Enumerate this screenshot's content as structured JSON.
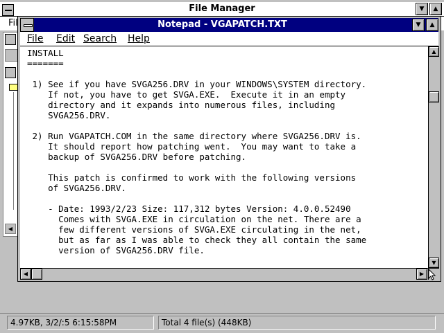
{
  "file_manager": {
    "title": "File Manager",
    "menu_peek": "Fil",
    "status": {
      "selected": "4.97KB, 3/2/:5 6:15:58PM",
      "total": "Total 4 file(s) (448KB)"
    }
  },
  "notepad": {
    "title": "Notepad - VGAPATCH.TXT",
    "menu": {
      "file": "File",
      "edit": "Edit",
      "search": "Search",
      "help": "Help"
    },
    "lines": [
      "INSTALL",
      "=======",
      "",
      " 1) See if you have SVGA256.DRV in your WINDOWS\\SYSTEM directory.",
      "    If not, you have to get SVGA.EXE.  Execute it in an empty",
      "    directory and it expands into numerous files, including",
      "    SVGA256.DRV.",
      "",
      " 2) Run VGAPATCH.COM in the same directory where SVGA256.DRV is.",
      "    It should report how patching went.  You may want to take a",
      "    backup of SVGA256.DRV before patching.",
      "",
      "    This patch is confirmed to work with the following versions",
      "    of SVGA256.DRV.",
      "",
      "    - Date: 1993/2/23 Size: 117,312 bytes Version: 4.0.0.52490",
      "      Comes with SVGA.EXE in circulation on the net. There are a",
      "      few different versions of SVGA.EXE circulating in the net,",
      "      but as far as I was able to check they all contain the same",
      "      version of SVGA256.DRV file."
    ]
  },
  "icons": [
    "system-menu-icon",
    "minimize-icon",
    "maximize-icon",
    "scroll-up-icon",
    "scroll-down-icon",
    "scroll-left-icon",
    "scroll-right-icon",
    "folder-icon",
    "mouse-cursor-icon"
  ]
}
